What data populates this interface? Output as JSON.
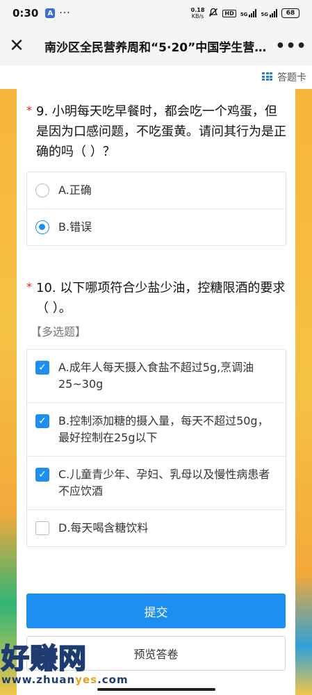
{
  "status_bar": {
    "time": "0:30",
    "app_badge": "A",
    "dots": "···",
    "net_speed_value": "0.18",
    "net_speed_unit": "KB/s",
    "hd_label": "HD",
    "sig1": "5G",
    "sig2": "5G",
    "battery": "68"
  },
  "nav": {
    "close_icon": "✕",
    "title": "南沙区全民营养周和“5·20”中国学生营养日…",
    "more_icon": "•••"
  },
  "sheet": {
    "label": "答题卡"
  },
  "q9": {
    "required_mark": "*",
    "title": "9. 小明每天吃早餐时，都会吃一个鸡蛋，但是因为口感问题，不吃蛋黄。请问其行为是正确的吗（ ）？",
    "options": [
      {
        "label": "A.正确",
        "selected": false
      },
      {
        "label": "B.错误",
        "selected": true
      }
    ]
  },
  "q10": {
    "required_mark": "*",
    "title": "10. 以下哪项符合少盐少油，控糖限酒的要求（ ）。",
    "hint": "【多选题】",
    "options": [
      {
        "label": "A.成年人每天摄入食盐不超过5g,烹调油25~30g",
        "checked": true
      },
      {
        "label": "B.控制添加糖的摄入量，每天不超过50g，最好控制在25g以下",
        "checked": true
      },
      {
        "label": "C.儿童青少年、孕妇、乳母以及慢性病患者不应饮酒",
        "checked": true
      },
      {
        "label": "D.每天喝含糖饮料",
        "checked": false
      }
    ]
  },
  "buttons": {
    "submit": "提交",
    "preview": "预览答卷"
  },
  "watermark": {
    "big": "好赚网",
    "small_a": "www.zhuan",
    "small_b": "yes",
    "small_c": ".com"
  },
  "colors": {
    "accent": "#1d8ff0",
    "required": "#e2231a"
  }
}
